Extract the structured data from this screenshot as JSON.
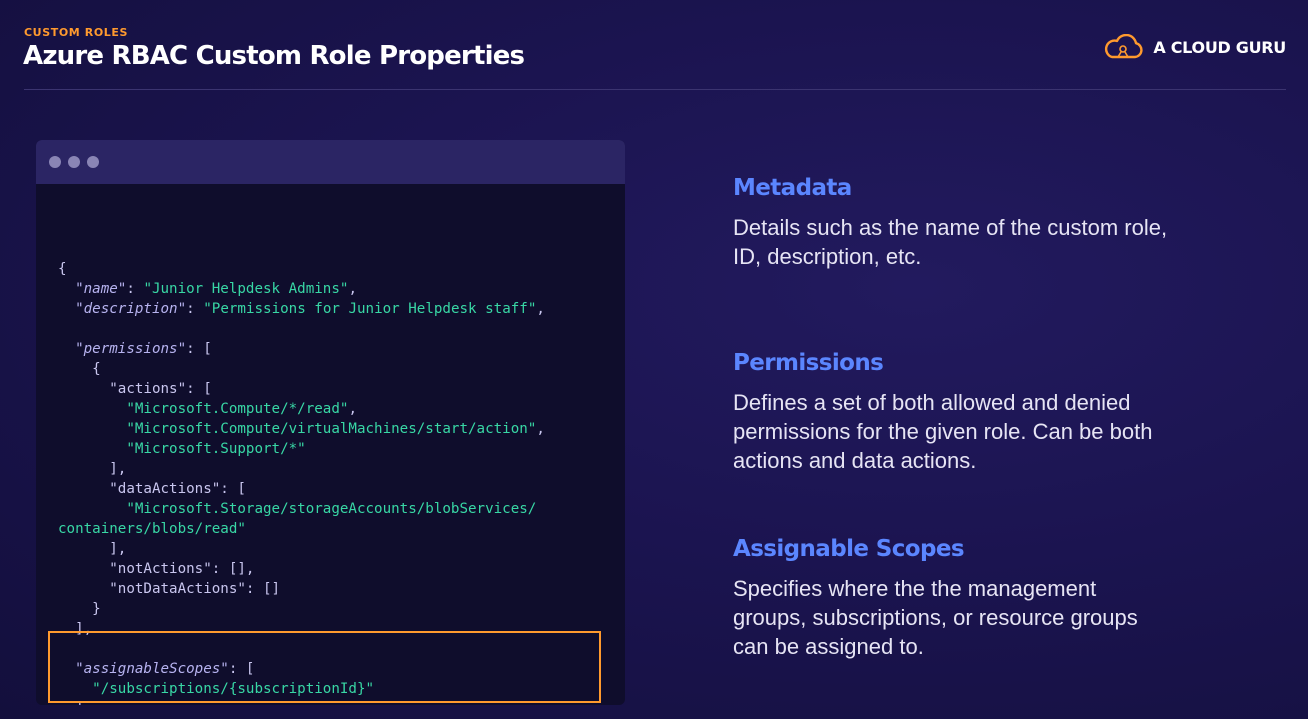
{
  "header": {
    "eyebrow": "CUSTOM ROLES",
    "title": "Azure RBAC Custom Role Properties",
    "brand": "A CLOUD GURU",
    "brand_icon": "cloud-logo-icon",
    "accent_color": "#ff9a2e"
  },
  "code": {
    "window_dots": [
      "window-dot",
      "window-dot",
      "window-dot"
    ],
    "lines": [
      {
        "indent": "",
        "parts": [
          [
            "p",
            "{"
          ]
        ]
      },
      {
        "indent": "  ",
        "parts": [
          [
            "ki",
            "\"name\""
          ],
          [
            "p",
            ": "
          ],
          [
            "s",
            "\"Junior Helpdesk Admins\""
          ],
          [
            "p",
            ","
          ]
        ]
      },
      {
        "indent": "  ",
        "parts": [
          [
            "ki",
            "\"description\""
          ],
          [
            "p",
            ": "
          ],
          [
            "s",
            "\"Permissions for Junior Helpdesk staff\""
          ],
          [
            "p",
            ","
          ]
        ]
      },
      {
        "indent": "",
        "parts": []
      },
      {
        "indent": "  ",
        "parts": [
          [
            "ki",
            "\"permissions\""
          ],
          [
            "p",
            ": ["
          ]
        ]
      },
      {
        "indent": "    ",
        "parts": [
          [
            "p",
            "{"
          ]
        ]
      },
      {
        "indent": "      ",
        "parts": [
          [
            "k",
            "\"actions\""
          ],
          [
            "p",
            ": ["
          ]
        ]
      },
      {
        "indent": "        ",
        "parts": [
          [
            "s",
            "\"Microsoft.Compute/*/read\""
          ],
          [
            "p",
            ","
          ]
        ]
      },
      {
        "indent": "        ",
        "parts": [
          [
            "s",
            "\"Microsoft.Compute/virtualMachines/start/action\""
          ],
          [
            "p",
            ","
          ]
        ]
      },
      {
        "indent": "        ",
        "parts": [
          [
            "s",
            "\"Microsoft.Support/*\""
          ]
        ]
      },
      {
        "indent": "      ",
        "parts": [
          [
            "p",
            "],"
          ]
        ]
      },
      {
        "indent": "      ",
        "parts": [
          [
            "k",
            "\"dataActions\""
          ],
          [
            "p",
            ": ["
          ]
        ]
      },
      {
        "indent": "        ",
        "parts": [
          [
            "s",
            "\"Microsoft.Storage/storageAccounts/blobServices/"
          ]
        ]
      },
      {
        "indent": "",
        "parts": [
          [
            "s",
            "containers/blobs/read\""
          ]
        ]
      },
      {
        "indent": "      ",
        "parts": [
          [
            "p",
            "],"
          ]
        ]
      },
      {
        "indent": "      ",
        "parts": [
          [
            "k",
            "\"notActions\""
          ],
          [
            "p",
            ": [],"
          ]
        ]
      },
      {
        "indent": "      ",
        "parts": [
          [
            "k",
            "\"notDataActions\""
          ],
          [
            "p",
            ": []"
          ]
        ]
      },
      {
        "indent": "    ",
        "parts": [
          [
            "p",
            "}"
          ]
        ]
      },
      {
        "indent": "  ",
        "parts": [
          [
            "p",
            "],"
          ]
        ]
      },
      {
        "indent": "",
        "parts": []
      },
      {
        "indent": "  ",
        "parts": [
          [
            "ki",
            "\"assignableScopes\""
          ],
          [
            "p",
            ": ["
          ]
        ]
      },
      {
        "indent": "    ",
        "parts": [
          [
            "s",
            "\"/subscriptions/{subscriptionId}\""
          ]
        ]
      },
      {
        "indent": "  ",
        "parts": [
          [
            "p",
            "]"
          ]
        ]
      },
      {
        "indent": "",
        "parts": [
          [
            "p",
            "}"
          ]
        ]
      }
    ]
  },
  "sections": [
    {
      "id": "metadata",
      "heading": "Metadata",
      "body_lines": [
        "Details such as the name of the custom role,",
        "ID, description, etc."
      ]
    },
    {
      "id": "permissions",
      "heading": "Permissions",
      "body_lines": [
        "Defines a set of both allowed and denied",
        "permissions for the given role. Can be both",
        "actions and data actions."
      ]
    },
    {
      "id": "assignable-scopes",
      "heading": "Assignable Scopes",
      "body_lines": [
        "Specifies where the the management",
        "groups, subscriptions, or resource groups",
        "can be assigned to."
      ]
    }
  ]
}
